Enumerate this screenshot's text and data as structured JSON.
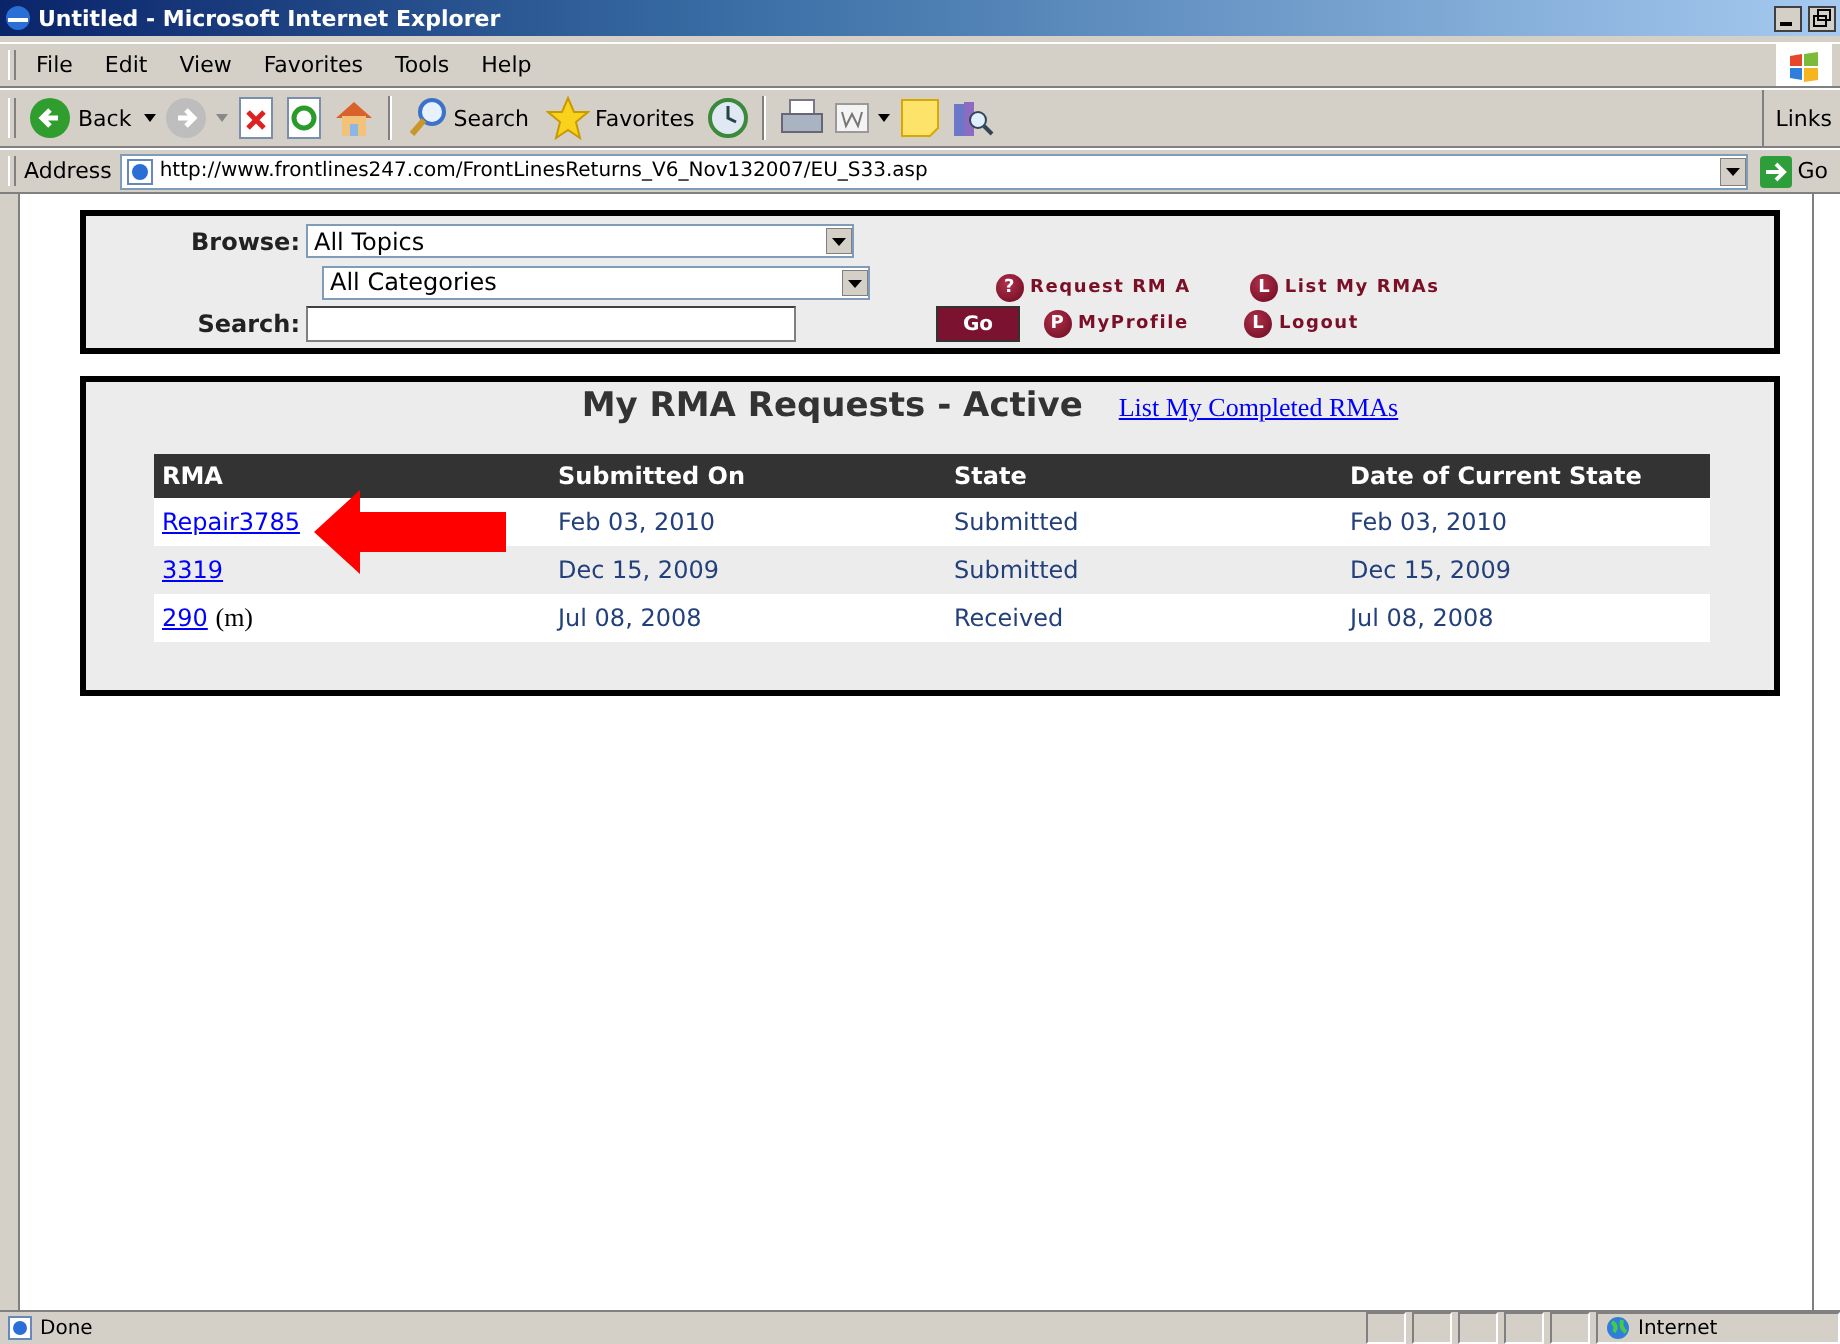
{
  "window": {
    "title": "Untitled - Microsoft Internet Explorer"
  },
  "menu": [
    "File",
    "Edit",
    "View",
    "Favorites",
    "Tools",
    "Help"
  ],
  "toolbar": {
    "back": "Back",
    "search": "Search",
    "favorites": "Favorites",
    "links": "Links"
  },
  "address": {
    "label": "Address",
    "url": "http://www.frontlines247.com/FrontLinesReturns_V6_Nov132007/EU_S33.asp",
    "go": "Go"
  },
  "filter": {
    "browse_label": "Browse:",
    "topic": "All Topics",
    "category": "All Categories",
    "search_label": "Search:",
    "go": "Go",
    "top_links": [
      {
        "badge": "?",
        "label": "Request RM A"
      },
      {
        "badge": "L",
        "label": "List My RMAs"
      }
    ],
    "bottom_links": [
      {
        "badge": "P",
        "label": "MyProfile"
      },
      {
        "badge": "L",
        "label": "Logout"
      }
    ]
  },
  "results": {
    "title": "My RMA Requests - Active",
    "completed_link": "List My Completed RMAs",
    "columns": [
      "RMA",
      "Submitted On",
      "State",
      "Date of Current State"
    ],
    "rows": [
      {
        "rma": "Repair3785",
        "submitted": "Feb 03, 2010",
        "state": "Submitted",
        "current": "Feb 03, 2010",
        "pointed": true
      },
      {
        "rma": "3319",
        "submitted": "Dec 15, 2009",
        "state": "Submitted",
        "current": "Dec 15, 2009",
        "pointed": false
      },
      {
        "rma": "290",
        "note": "(m)",
        "submitted": "Jul 08, 2008",
        "state": "Received",
        "current": "Jul 08, 2008",
        "pointed": false
      }
    ]
  },
  "status": {
    "text": "Done",
    "zone": "Internet"
  }
}
